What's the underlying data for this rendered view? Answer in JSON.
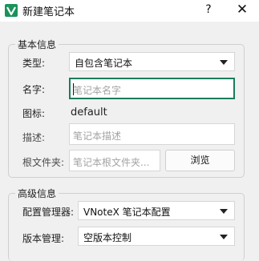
{
  "window": {
    "title": "新建笔记本",
    "app_icon": "vnote-logo-icon",
    "help_label": "?",
    "close_label": "✕"
  },
  "basic": {
    "title": "基本信息",
    "type_label": "类型:",
    "type_value": "自包含笔记本",
    "name_label": "名字:",
    "name_placeholder": "笔记本名字",
    "icon_label": "图标:",
    "icon_value": "default",
    "desc_label": "描述:",
    "desc_placeholder": "笔记本描述",
    "root_label": "根文件夹:",
    "root_placeholder": "笔记本根文件夹...",
    "browse_label": "浏览"
  },
  "advanced": {
    "title": "高级信息",
    "config_mgr_label": "配置管理器:",
    "config_mgr_value": "VNoteX 笔记本配置",
    "version_label": "版本管理:",
    "version_value": "空版本控制"
  },
  "colors": {
    "accent": "#1b7d5a",
    "app_icon_bg": "#19935a"
  }
}
